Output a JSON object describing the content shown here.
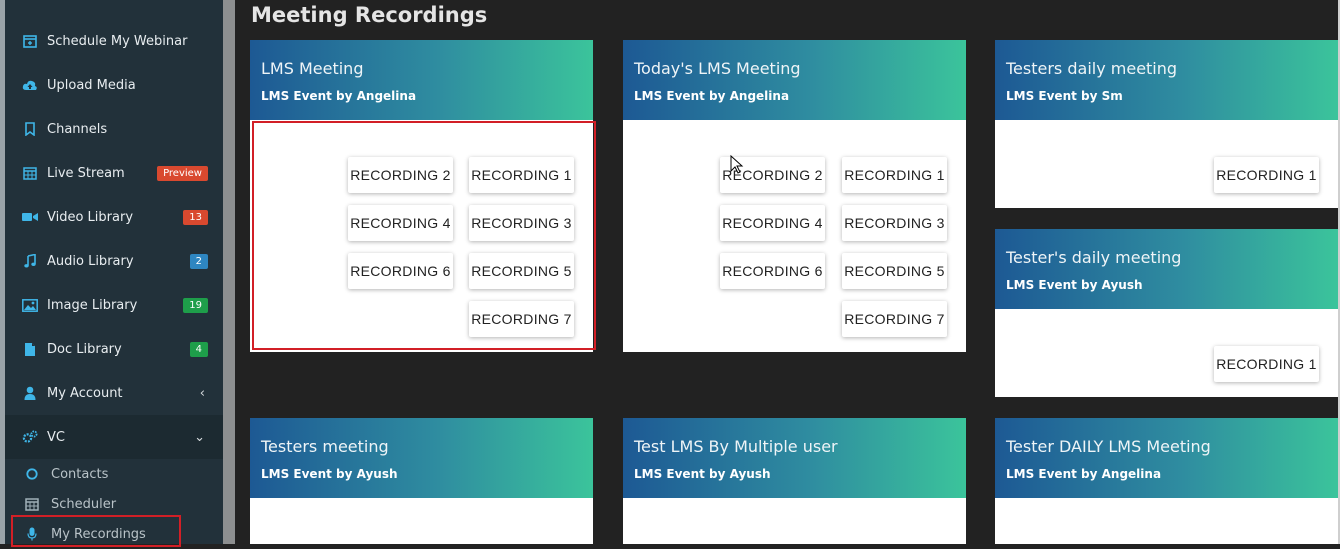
{
  "sidebar": {
    "items": [
      {
        "label": "Schedule My Webinar",
        "icon": "calendar-plus-icon"
      },
      {
        "label": "Upload Media",
        "icon": "cloud-upload-icon"
      },
      {
        "label": "Channels",
        "icon": "bookmark-icon"
      },
      {
        "label": "Live Stream",
        "icon": "calendar-grid-icon",
        "badge": "Preview",
        "badge_color": "#d9492f"
      },
      {
        "label": "Video Library",
        "icon": "video-camera-icon",
        "badge": "13",
        "badge_color": "#d9492f"
      },
      {
        "label": "Audio Library",
        "icon": "music-note-icon",
        "badge": "2",
        "badge_color": "#2e86c1"
      },
      {
        "label": "Image Library",
        "icon": "image-icon",
        "badge": "19",
        "badge_color": "#1e9e4a"
      },
      {
        "label": "Doc Library",
        "icon": "document-icon",
        "badge": "4",
        "badge_color": "#1e9e4a"
      },
      {
        "label": "My Account",
        "icon": "user-icon",
        "chevron": "‹"
      },
      {
        "label": "VC",
        "icon": "gears-icon",
        "chevron": "⌄"
      }
    ],
    "sub_items": [
      {
        "label": "Contacts",
        "icon": "circle-icon"
      },
      {
        "label": "Scheduler",
        "icon": "calendar-grid-icon"
      },
      {
        "label": "My Recordings",
        "icon": "microphone-icon"
      }
    ]
  },
  "main": {
    "title": "Meeting Recordings",
    "cards": [
      {
        "title": "LMS Meeting",
        "subtitle": "LMS Event by Angelina",
        "recordings": [
          "RECORDING 2",
          "RECORDING 1",
          "RECORDING 4",
          "RECORDING 3",
          "RECORDING 6",
          "RECORDING 5",
          "RECORDING 7"
        ]
      },
      {
        "title": "Today's LMS Meeting",
        "subtitle": "LMS Event by Angelina",
        "recordings": [
          "RECORDING 2",
          "RECORDING 1",
          "RECORDING 4",
          "RECORDING 3",
          "RECORDING 6",
          "RECORDING 5",
          "RECORDING 7"
        ]
      },
      {
        "title": "Testers daily meeting",
        "subtitle": "LMS Event by Sm",
        "recordings": [
          "RECORDING 1"
        ]
      },
      {
        "title": "Tester's daily meeting",
        "subtitle": "LMS Event by Ayush",
        "recordings": [
          "RECORDING 1"
        ]
      },
      {
        "title": "Testers meeting",
        "subtitle": "LMS Event by Ayush",
        "recordings": []
      },
      {
        "title": "Test LMS By Multiple user",
        "subtitle": "LMS Event by Ayush",
        "recordings": []
      },
      {
        "title": "Tester DAILY LMS Meeting",
        "subtitle": "LMS Event by Angelina",
        "recordings": []
      }
    ]
  },
  "colors": {
    "highlight": "#d21f26",
    "accent_start": "#1d5994",
    "accent_end": "#3bc49b"
  }
}
